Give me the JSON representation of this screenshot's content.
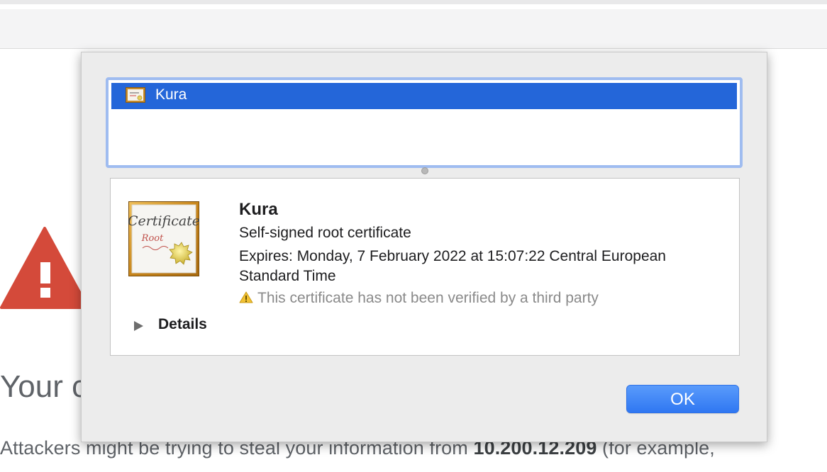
{
  "page": {
    "heading_partial": "Your c",
    "body_prefix": "Attackers might be trying to steal your information from ",
    "body_host": "10.200.12.209",
    "body_suffix": " (for example,"
  },
  "certificate_list": {
    "items": [
      {
        "label": "Kura",
        "selected": true,
        "icon": "certificate-icon"
      }
    ]
  },
  "certificate_detail": {
    "name": "Kura",
    "kind": "Self-signed root certificate",
    "expires": "Expires: Monday, 7 February 2022 at 15:07:22 Central European Standard Time",
    "warning": "This certificate has not been verified by a third party",
    "details_label": "Details",
    "image_icon": "certificate-root-icon"
  },
  "buttons": {
    "ok_label": "OK"
  },
  "colors": {
    "selection": "#2466d9",
    "accent_button": "#2f77f2",
    "warning_red": "#d44a3a",
    "warning_yellow": "#f2c233"
  }
}
